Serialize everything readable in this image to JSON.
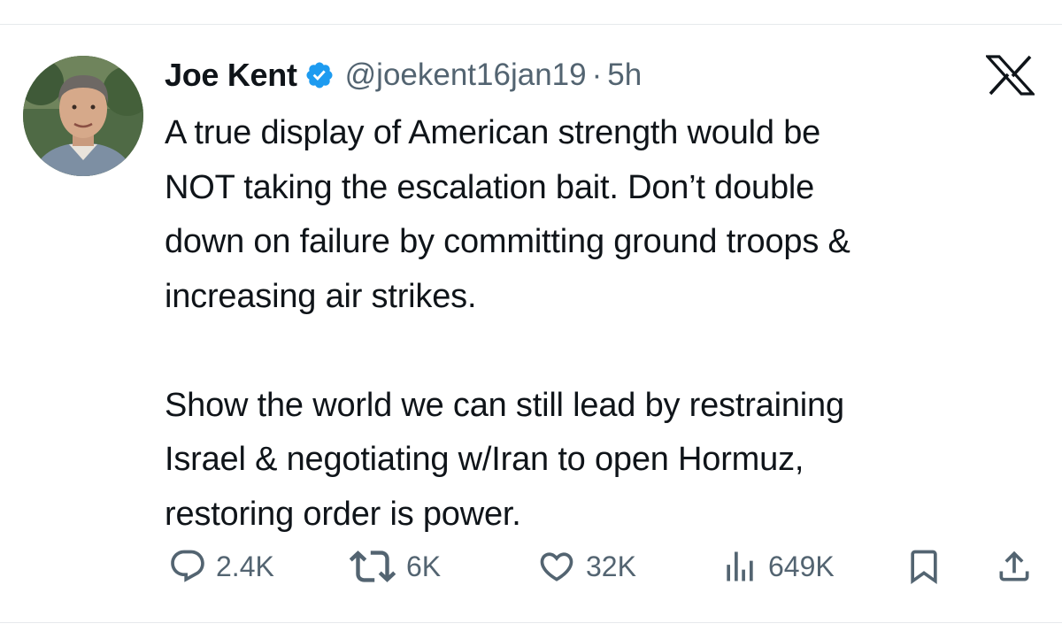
{
  "tweet": {
    "author": {
      "display_name": "Joe Kent",
      "handle": "@joekent16jan19",
      "verified": true
    },
    "separator": "·",
    "time_ago": "5h",
    "paragraphs": [
      "A true display of American strength would be\nNOT taking the escalation bait. Don’t double\ndown on failure by committing ground troops &\nincreasing air strikes.",
      "Show the world we can still lead by restraining\nIsrael & negotiating w/Iran to open Hormuz,\nrestoring order is power."
    ]
  },
  "actions": {
    "replies": "2.4K",
    "reposts": "6K",
    "likes": "32K",
    "views": "649K"
  },
  "icons": {
    "brand": "x-logo-icon",
    "verified": "verified-badge-icon",
    "reply": "reply-icon",
    "repost": "repost-icon",
    "like": "heart-icon",
    "views": "views-icon",
    "bookmark": "bookmark-icon",
    "share": "share-icon"
  },
  "colors": {
    "text": "#0f1419",
    "secondary": "#536471",
    "verified": "#1d9bf0"
  }
}
